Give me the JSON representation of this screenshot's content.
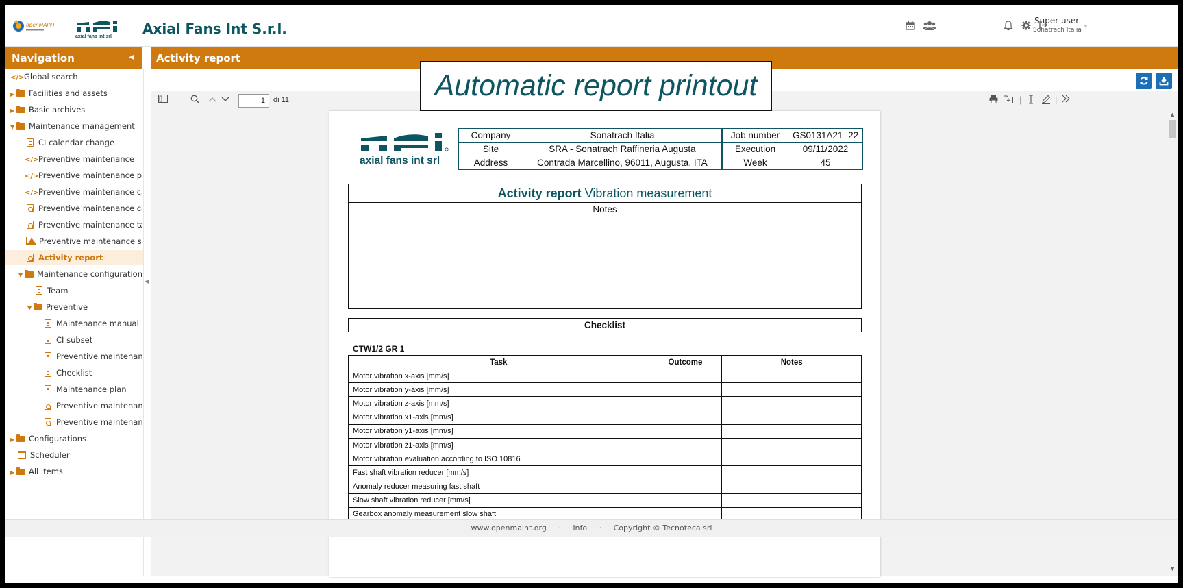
{
  "header": {
    "openmaint_logo_text": "openMAINT",
    "afi_logo_text": "axial fans int srl",
    "app_title": "Axial Fans Int S.r.l.",
    "user_name": "Super user",
    "user_org": "Sonatrach Italia",
    "icons": [
      "calendar-icon",
      "users-icon",
      "bell-icon",
      "gear-icon",
      "logout-icon"
    ]
  },
  "navigation": {
    "title": "Navigation",
    "items": [
      {
        "label": "Global search",
        "icon": "code-icon"
      },
      {
        "label": "Facilities and assets",
        "icon": "folder-icon"
      },
      {
        "label": "Basic archives",
        "icon": "folder-icon"
      },
      {
        "label": "Maintenance management",
        "icon": "folder-icon"
      },
      {
        "label": "CI calendar change",
        "icon": "document-icon"
      },
      {
        "label": "Preventive maintenance",
        "icon": "code-icon"
      },
      {
        "label": "Preventive maintenance pl...",
        "icon": "code-icon"
      },
      {
        "label": "Preventive maintenance cal...",
        "icon": "code-icon"
      },
      {
        "label": "Preventive maintenance cal...",
        "icon": "pdf-icon"
      },
      {
        "label": "Preventive maintenance ta...",
        "icon": "pdf-icon"
      },
      {
        "label": "Preventive maintenance su...",
        "icon": "chart-icon"
      },
      {
        "label": "Activity report",
        "icon": "pdf-icon"
      },
      {
        "label": "Maintenance configuration",
        "icon": "folder-icon"
      },
      {
        "label": "Team",
        "icon": "document-icon"
      },
      {
        "label": "Preventive",
        "icon": "folder-icon"
      },
      {
        "label": "Maintenance manual",
        "icon": "document-icon"
      },
      {
        "label": "CI subset",
        "icon": "document-icon"
      },
      {
        "label": "Preventive maintenan...",
        "icon": "document-icon"
      },
      {
        "label": "Checklist",
        "icon": "document-icon"
      },
      {
        "label": "Maintenance plan",
        "icon": "document-icon"
      },
      {
        "label": "Preventive maintenan...",
        "icon": "pdf-icon"
      },
      {
        "label": "Preventive maintenan...",
        "icon": "pdf-icon"
      },
      {
        "label": "Configurations",
        "icon": "folder-icon"
      },
      {
        "label": "Scheduler",
        "icon": "calendar-icon"
      },
      {
        "label": "All items",
        "icon": "folder-icon"
      }
    ]
  },
  "main": {
    "title": "Activity report",
    "caption": "Automatic report printout"
  },
  "pdf_toolbar": {
    "page_current": "1",
    "page_of": "di 11"
  },
  "report": {
    "logo_text": "axial fans int srl",
    "info_left": [
      {
        "label": "Company",
        "value": "Sonatrach Italia"
      },
      {
        "label": "Site",
        "value": "SRA - Sonatrach Raffineria Augusta"
      },
      {
        "label": "Address",
        "value": "Contrada Marcellino, 96011, Augusta, ITA"
      }
    ],
    "info_right": [
      {
        "label": "Job number",
        "value": "GS0131A21_22"
      },
      {
        "label": "Execution",
        "value": "09/11/2022"
      },
      {
        "label": "Week",
        "value": "45"
      }
    ],
    "activity_title_bold": "Activity report",
    "activity_title_rest": "Vibration measurement",
    "notes_label": "Notes",
    "checklist_title": "Checklist",
    "group_title": "CTW1/2 GR 1",
    "columns": [
      "Task",
      "Outcome",
      "Notes"
    ],
    "tasks": [
      "Motor vibration x-axis [mm/s]",
      "Motor vibration y-axis [mm/s]",
      "Motor vibration z-axis [mm/s]",
      "Motor vibration x1-axis [mm/s]",
      "Motor vibration y1-axis [mm/s]",
      "Motor vibration z1-axis [mm/s]",
      "Motor vibration evaluation according to ISO 10816",
      "Fast shaft vibration reducer [mm/s]",
      "Anomaly reducer measuring fast shaft",
      "Slow shaft vibration reducer [mm/s]",
      "Gearbox anomaly measurement slow shaft"
    ]
  },
  "footer": {
    "site": "www.openmaint.org",
    "info": "Info",
    "copyright": "Copyright © Tecnoteca srl",
    "sep": "·"
  }
}
